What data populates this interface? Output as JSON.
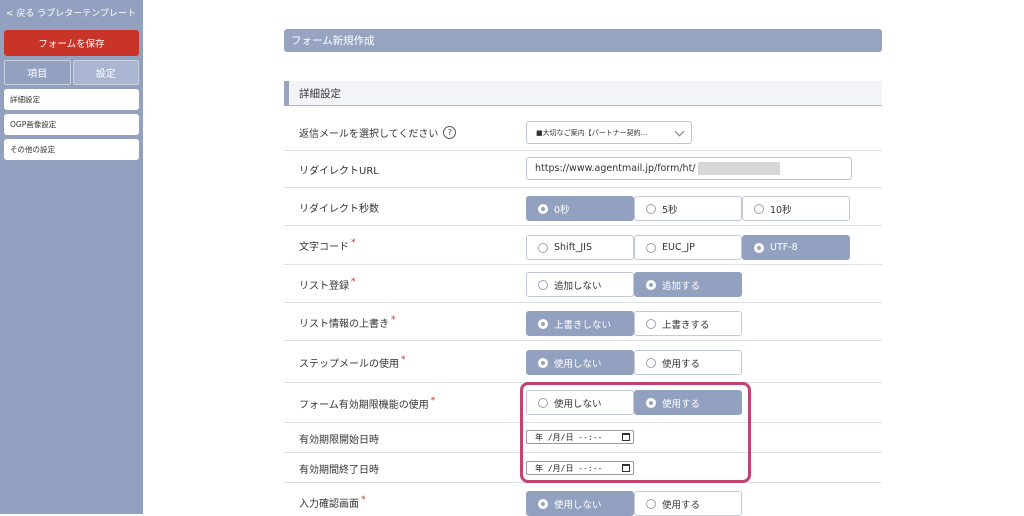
{
  "sidebar": {
    "back_label": "< 戻る ラブレターテンプレート",
    "save_label": "フォームを保存",
    "tabs": [
      "項目",
      "設定"
    ],
    "items": [
      "詳細設定",
      "OGP画像設定",
      "その他の設定"
    ]
  },
  "header": {
    "title": "フォーム新規作成"
  },
  "section": {
    "title": "詳細設定"
  },
  "fields": {
    "reply_mail": {
      "label": "返信メールを選択してください",
      "help": "?",
      "value": "■大切なご案内【パートナー契約..."
    },
    "redirect_url": {
      "label": "リダイレクトURL",
      "value": "https://www.agentmail.jp/form/ht/"
    },
    "redirect_seconds": {
      "label": "リダイレクト秒数",
      "options": [
        "0秒",
        "5秒",
        "10秒"
      ],
      "selected": 0
    },
    "charset": {
      "label": "文字コード",
      "options": [
        "Shift_JIS",
        "EUC_JP",
        "UTF-8"
      ],
      "selected": 2
    },
    "list_register": {
      "label": "リスト登録",
      "options": [
        "追加しない",
        "追加する"
      ],
      "selected": 1
    },
    "list_overwrite": {
      "label": "リスト情報の上書き",
      "options": [
        "上書きしない",
        "上書きする"
      ],
      "selected": 0
    },
    "step_mail": {
      "label": "ステップメールの使用",
      "options": [
        "使用しない",
        "使用する"
      ],
      "selected": 0
    },
    "form_expiry": {
      "label": "フォーム有効期限機能の使用",
      "options": [
        "使用しない",
        "使用する"
      ],
      "selected": 1
    },
    "expiry_start": {
      "label": "有効期限開始日時",
      "value": "年 /月/日 --:--"
    },
    "expiry_end": {
      "label": "有効期間終了日時",
      "value": "年 /月/日 --:--"
    },
    "confirm_screen": {
      "label": "入力確認画面",
      "options": [
        "使用しない",
        "使用する"
      ],
      "selected": 0
    }
  },
  "required_mark": "*",
  "colors": {
    "sidebar": "#93a1c1",
    "save_button": "#c93428",
    "selected_radio": "#93a1c1",
    "highlight": "#c4426f",
    "required": "#cc2a2a"
  }
}
